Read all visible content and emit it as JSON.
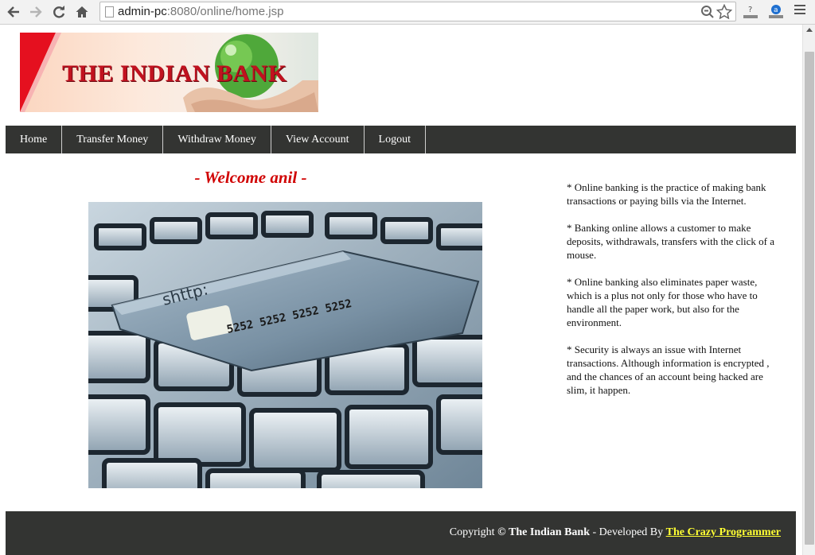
{
  "browser": {
    "url_host": "admin-pc",
    "url_path": ":8080/online/home.jsp",
    "icons": [
      "back-icon",
      "forward-icon",
      "reload-icon",
      "home-icon",
      "page-icon",
      "zoom-icon",
      "star-icon",
      "extension-icon",
      "menu-icon"
    ]
  },
  "header": {
    "logo_text": "THE INDIAN BANK"
  },
  "nav": {
    "items": [
      {
        "label": "Home"
      },
      {
        "label": "Transfer Money"
      },
      {
        "label": "Withdraw Money"
      },
      {
        "label": "View Account"
      },
      {
        "label": "Logout"
      }
    ]
  },
  "main": {
    "welcome": "- Welcome anil -"
  },
  "info": {
    "paragraphs": [
      "* Online banking is the practice of making bank transactions or paying bills via the Internet.",
      "* Banking online allows a customer to make deposits, withdrawals, transfers with the click of a mouse.",
      "* Online banking also eliminates paper waste, which is a plus not only for those who have to handle all the paper work, but also for the environment.",
      "* Security is always an issue with Internet transactions. Although information is encrypted , and the chances of an account being hacked are slim, it happen."
    ]
  },
  "footer": {
    "prefix": "Copyright",
    "symbol": "©",
    "bank": "The Indian Bank",
    "middle": " - Developed By ",
    "link": "The Crazy Programmer"
  },
  "colors": {
    "navbar_bg": "#333432",
    "welcome": "#d00000",
    "footer_link": "#ffff33",
    "logo_red": "#c1121f"
  }
}
